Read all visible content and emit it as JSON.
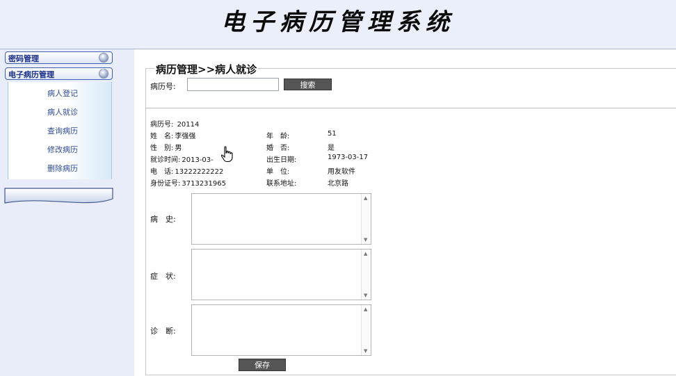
{
  "app": {
    "title": "电子病历管理系统"
  },
  "sidebar": {
    "menus": [
      {
        "label": "密码管理"
      },
      {
        "label": "电子病历管理"
      }
    ],
    "items": [
      {
        "label": "病人登记"
      },
      {
        "label": "病人就诊"
      },
      {
        "label": "查询病历"
      },
      {
        "label": "修改病历"
      },
      {
        "label": "删除病历"
      }
    ]
  },
  "main": {
    "breadcrumb": "病历管理>>病人就诊",
    "search": {
      "label": "病历号:",
      "value": "",
      "placeholder": "",
      "button": "搜索"
    },
    "fields": {
      "record_no": {
        "label": "病历号:",
        "value": "20114"
      },
      "name": {
        "label": "姓　名:",
        "value": "李强强"
      },
      "age": {
        "label": "年　龄:",
        "value": "51"
      },
      "gender": {
        "label": "性　别:",
        "value": "男"
      },
      "marital": {
        "label": "婚　否:",
        "value": "是"
      },
      "visit_time": {
        "label": "就诊时间:",
        "value": "2013-03-"
      },
      "birth_date": {
        "label": "出生日期:",
        "value": "1973-03-17"
      },
      "phone": {
        "label": "电　话:",
        "value": "13222222222"
      },
      "employer": {
        "label": "单　位:",
        "value": "用友软件"
      },
      "id_card": {
        "label": "身份证号:",
        "value": "3713231965"
      },
      "address": {
        "label": "联系地址:",
        "value": "北京路"
      }
    },
    "textareas": {
      "history": {
        "label": "病　史:",
        "value": ""
      },
      "symptoms": {
        "label": "症　状:",
        "value": ""
      },
      "diagnosis": {
        "label": "诊　断:",
        "value": ""
      }
    },
    "save_button": "保存"
  },
  "icons": {
    "cursor": "hand-pointer-icon",
    "menu_toggle": "circle-arrow-icon"
  },
  "colors": {
    "header_bg": "#ebeefb",
    "sidebar_bg": "#e9edfa",
    "menu_text": "#1a2f87",
    "button_bg": "#555555"
  }
}
